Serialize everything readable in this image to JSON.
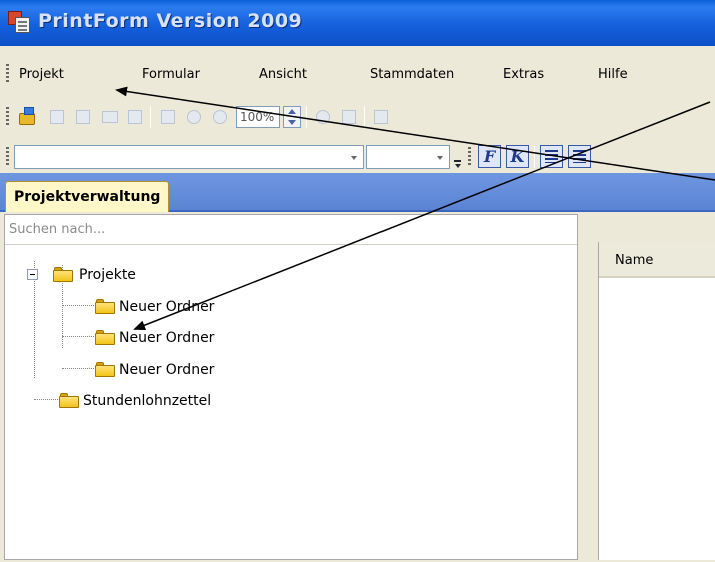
{
  "window": {
    "title": "PrintForm Version 2009"
  },
  "menu": {
    "items": [
      "Projekt",
      "Formular",
      "Ansicht",
      "Stammdaten",
      "Extras",
      "Hilfe"
    ]
  },
  "toolbar": {
    "zoom": "100%"
  },
  "tabs": {
    "active": "Projektverwaltung"
  },
  "search": {
    "placeholder": "Suchen nach..."
  },
  "tree": {
    "root": "Projekte",
    "children": [
      "Neuer Ordner",
      "Neuer Ordner",
      "Neuer Ordner"
    ],
    "sibling": "Stundenlohnzettel"
  },
  "list": {
    "column_header": "Name"
  },
  "format": {
    "bold_glyph": "F",
    "italic_glyph": "K"
  },
  "colors": {
    "titlebar": "#1560dc",
    "tab_active_bg": "#fff7c8",
    "folder": "#f2c418"
  }
}
